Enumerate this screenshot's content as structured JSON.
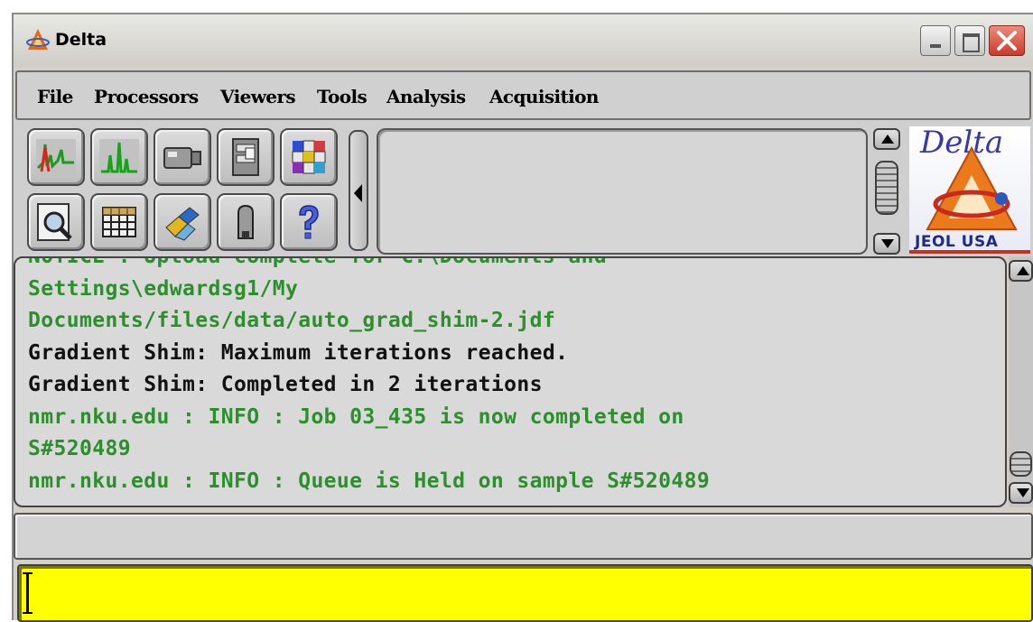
{
  "window": {
    "title": "Delta",
    "controls": [
      "minimize",
      "maximize",
      "close"
    ]
  },
  "menubar": {
    "items": [
      {
        "label": "File"
      },
      {
        "label": "Processors"
      },
      {
        "label": "Viewers"
      },
      {
        "label": "Tools"
      },
      {
        "label": "Analysis"
      },
      {
        "label": "Acquisition"
      }
    ]
  },
  "toolbar": {
    "buttons_row1": [
      {
        "icon": "spectrum-icon"
      },
      {
        "icon": "peaks-icon"
      },
      {
        "icon": "camera-icon"
      },
      {
        "icon": "file-cabinet-icon"
      },
      {
        "icon": "colored-blocks-icon"
      }
    ],
    "buttons_row2": [
      {
        "icon": "magnifier-icon"
      },
      {
        "icon": "table-icon"
      },
      {
        "icon": "puzzle-icon"
      },
      {
        "icon": "magnet-icon"
      },
      {
        "icon": "help-icon"
      }
    ],
    "logo": {
      "word": "Delta",
      "company": "JEOL USA"
    }
  },
  "log": {
    "lines": [
      {
        "text": "NOTICE : Upload complete for C:\\Documents and",
        "kind": "info"
      },
      {
        "text": "Settings\\edwardsg1/My",
        "kind": "info"
      },
      {
        "text": "Documents/files/data/auto_grad_shim-2.jdf",
        "kind": "info"
      },
      {
        "text": "Gradient Shim: Maximum iterations reached.",
        "kind": "plain"
      },
      {
        "text": "Gradient Shim: Completed in 2 iterations",
        "kind": "plain"
      },
      {
        "text": "nmr.nku.edu : INFO : Job 03_435 is now completed on",
        "kind": "info"
      },
      {
        "text": "S#520489",
        "kind": "info"
      },
      {
        "text": "nmr.nku.edu : INFO : Queue is Held on sample S#520489",
        "kind": "info"
      }
    ]
  },
  "status_bar": {
    "text": ""
  },
  "command_line": {
    "value": ""
  },
  "colors": {
    "info_text": "#2b8f2b",
    "plain_text": "#111111",
    "command_background": "#ffff00",
    "chrome": "#d0d0d0"
  }
}
